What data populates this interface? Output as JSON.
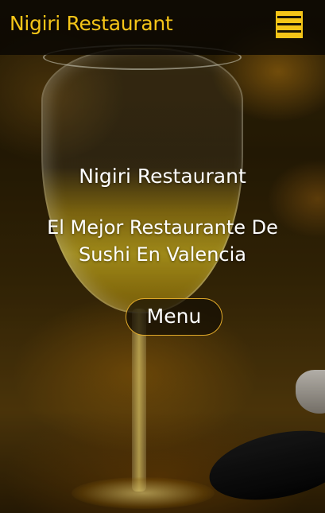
{
  "header": {
    "brand": "Nigiri Restaurant",
    "menu_icon": "hamburger-icon"
  },
  "hero": {
    "title": "Nigiri Restaurant",
    "subtitle": "El Mejor Restaurante De Sushi En Valencia",
    "button_label": "Menu"
  },
  "colors": {
    "accent": "#f5c518",
    "button_border": "#e0a92a",
    "text": "#ffffff"
  }
}
